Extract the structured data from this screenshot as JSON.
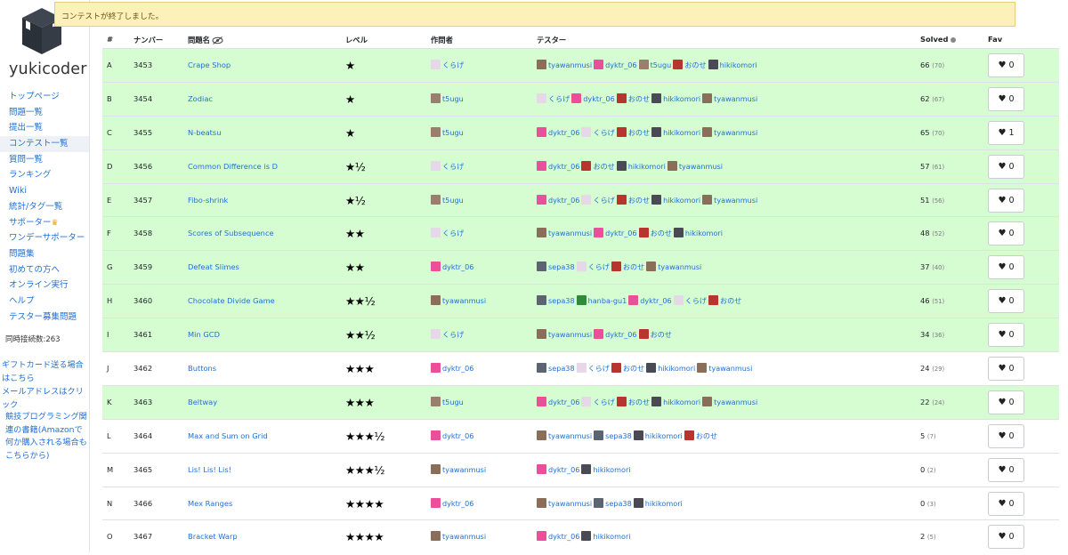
{
  "app": {
    "brand": "yukicoder",
    "online_count": "同時接続数:263"
  },
  "alert": {
    "message": "コンテストが終了しました。"
  },
  "sidebar": {
    "items": [
      {
        "label": "トップページ"
      },
      {
        "label": "問題一覧"
      },
      {
        "label": "提出一覧"
      },
      {
        "label": "コンテスト一覧",
        "active": true
      },
      {
        "label": "質問一覧"
      },
      {
        "label": "ランキング"
      },
      {
        "label": "Wiki"
      },
      {
        "label": "統計/タグ一覧"
      },
      {
        "label": "サポーター"
      },
      {
        "label": "ワンデーサポーター"
      },
      {
        "label": "問題集"
      },
      {
        "label": "初めての方へ"
      },
      {
        "label": "オンライン実行"
      },
      {
        "label": "ヘルプ"
      },
      {
        "label": "テスター募集問題"
      }
    ],
    "gift_link": "ギフトカード送る場合はこちら",
    "mail_link": "メールアドレスはクリック",
    "books_link": "競技プログラミング関連の書籍(Amazonで何か購入される場合もこちらから)"
  },
  "table": {
    "headers": {
      "index": "#",
      "number": "ナンバー",
      "name": "問題名",
      "level": "レベル",
      "writer": "作問者",
      "testers": "テスター",
      "solved": "Solved",
      "fav": "Fav"
    },
    "rows": [
      {
        "index": "A",
        "number": "3453",
        "name": "Crape Shop",
        "level": "★",
        "writer": "くらげ",
        "testers": [
          "tyawanmusi",
          "dyktr_06",
          "t5ugu",
          "おのせ",
          "hikikomori"
        ],
        "solved": "66",
        "total": "(70)",
        "fav": "0",
        "solved_by_me": true
      },
      {
        "index": "B",
        "number": "3454",
        "name": "Zodiac",
        "level": "★",
        "writer": "t5ugu",
        "testers": [
          "くらげ",
          "dyktr_06",
          "おのせ",
          "hikikomori",
          "tyawanmusi"
        ],
        "solved": "62",
        "total": "(67)",
        "fav": "0",
        "solved_by_me": true
      },
      {
        "index": "C",
        "number": "3455",
        "name": "N-beatsu",
        "level": "★",
        "writer": "t5ugu",
        "testers": [
          "dyktr_06",
          "くらげ",
          "おのせ",
          "hikikomori",
          "tyawanmusi"
        ],
        "solved": "65",
        "total": "(70)",
        "fav": "1",
        "solved_by_me": true
      },
      {
        "index": "D",
        "number": "3456",
        "name": "Common Difference is D",
        "level": "★½",
        "writer": "くらげ",
        "testers": [
          "dyktr_06",
          "おのせ",
          "hikikomori",
          "tyawanmusi"
        ],
        "solved": "57",
        "total": "(61)",
        "fav": "0",
        "solved_by_me": true
      },
      {
        "index": "E",
        "number": "3457",
        "name": "Fibo-shrink",
        "level": "★½",
        "writer": "t5ugu",
        "testers": [
          "dyktr_06",
          "くらげ",
          "おのせ",
          "hikikomori",
          "tyawanmusi"
        ],
        "solved": "51",
        "total": "(56)",
        "fav": "0",
        "solved_by_me": true
      },
      {
        "index": "F",
        "number": "3458",
        "name": "Scores of Subsequence",
        "level": "★★",
        "writer": "くらげ",
        "testers": [
          "tyawanmusi",
          "dyktr_06",
          "おのせ",
          "hikikomori"
        ],
        "solved": "48",
        "total": "(52)",
        "fav": "0",
        "solved_by_me": true
      },
      {
        "index": "G",
        "number": "3459",
        "name": "Defeat Slimes",
        "level": "★★",
        "writer": "dyktr_06",
        "testers": [
          "sepa38",
          "くらげ",
          "おのせ",
          "tyawanmusi"
        ],
        "solved": "37",
        "total": "(40)",
        "fav": "0",
        "solved_by_me": true
      },
      {
        "index": "H",
        "number": "3460",
        "name": "Chocolate Divide Game",
        "level": "★★½",
        "writer": "tyawanmusi",
        "testers": [
          "sepa38",
          "hanba-gu1",
          "dyktr_06",
          "くらげ",
          "おのせ"
        ],
        "solved": "46",
        "total": "(51)",
        "fav": "0",
        "solved_by_me": true
      },
      {
        "index": "I",
        "number": "3461",
        "name": "Min GCD",
        "level": "★★½",
        "writer": "くらげ",
        "testers": [
          "tyawanmusi",
          "dyktr_06",
          "おのせ"
        ],
        "solved": "34",
        "total": "(36)",
        "fav": "0",
        "solved_by_me": true
      },
      {
        "index": "J",
        "number": "3462",
        "name": "Buttons",
        "level": "★★★",
        "writer": "dyktr_06",
        "testers": [
          "sepa38",
          "くらげ",
          "おのせ",
          "hikikomori",
          "tyawanmusi"
        ],
        "solved": "24",
        "total": "(29)",
        "fav": "0",
        "solved_by_me": false
      },
      {
        "index": "K",
        "number": "3463",
        "name": "Beltway",
        "level": "★★★",
        "writer": "t5ugu",
        "testers": [
          "dyktr_06",
          "くらげ",
          "おのせ",
          "hikikomori",
          "tyawanmusi"
        ],
        "solved": "22",
        "total": "(24)",
        "fav": "0",
        "solved_by_me": true
      },
      {
        "index": "L",
        "number": "3464",
        "name": "Max and Sum on Grid",
        "level": "★★★½",
        "writer": "dyktr_06",
        "testers": [
          "tyawanmusi",
          "sepa38",
          "hikikomori",
          "おのせ"
        ],
        "solved": "5",
        "total": "(7)",
        "fav": "0",
        "solved_by_me": false
      },
      {
        "index": "M",
        "number": "3465",
        "name": "Lis! Lis! Lis!",
        "level": "★★★½",
        "writer": "tyawanmusi",
        "testers": [
          "dyktr_06",
          "hikikomori"
        ],
        "solved": "0",
        "total": "(2)",
        "fav": "0",
        "solved_by_me": false
      },
      {
        "index": "N",
        "number": "3466",
        "name": "Mex Ranges",
        "level": "★★★★",
        "writer": "dyktr_06",
        "testers": [
          "tyawanmusi",
          "sepa38",
          "hikikomori"
        ],
        "solved": "0",
        "total": "(3)",
        "fav": "0",
        "solved_by_me": false
      },
      {
        "index": "O",
        "number": "3467",
        "name": "Bracket Warp",
        "level": "★★★★",
        "writer": "tyawanmusi",
        "testers": [
          "dyktr_06",
          "hikikomori"
        ],
        "solved": "2",
        "total": "(5)",
        "fav": "0",
        "solved_by_me": false
      }
    ]
  },
  "colors": {
    "solved_row": "#d6fdd2",
    "link": "#1f6fd6",
    "alert_bg": "#fcf1b9"
  },
  "avatars": {
    "くらげ": "#e6d8e8",
    "tyawanmusi": "#8a6e5a",
    "dyktr_06": "#ec4f9a",
    "t5ugu": "#9b7f6e",
    "おのせ": "#b8342e",
    "hikikomori": "#4a4a55",
    "sepa38": "#5b6470",
    "hanba-gu1": "#2f8a3a"
  }
}
